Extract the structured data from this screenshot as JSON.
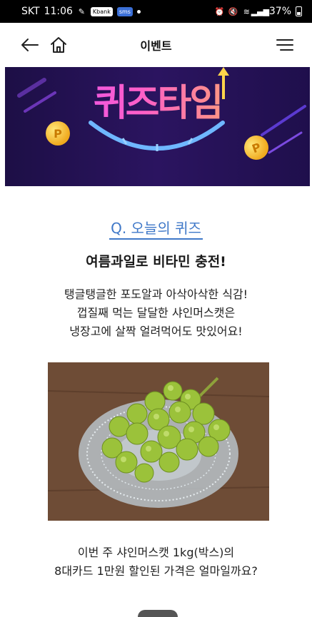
{
  "status_bar": {
    "carrier": "SKT",
    "time": "11:06",
    "badge1": "ℂ",
    "badge2": "Kbank",
    "badge3": "sms",
    "battery": "37%"
  },
  "header": {
    "title": "이벤트"
  },
  "banner": {
    "title": "퀴즈타임",
    "coin_label": "P"
  },
  "quiz": {
    "label": "Q. 오늘의 퀴즈",
    "title": "여름과일로 비타민 충전!",
    "desc_lines": [
      "탱글탱글한 포도알과 아삭아삭한 식감!",
      "껍질째 먹는 달달한 샤인머스캣은",
      "냉장고에 살짝 얼려먹어도 맛있어요!"
    ],
    "question_lines": [
      "이번 주 샤인머스캣 1kg(박스)의",
      "8대카드 1만원 할인된 가격은 얼마일까요?"
    ]
  },
  "colors": {
    "accent_blue": "#3f78c8",
    "banner_bg": "#2b1460"
  }
}
